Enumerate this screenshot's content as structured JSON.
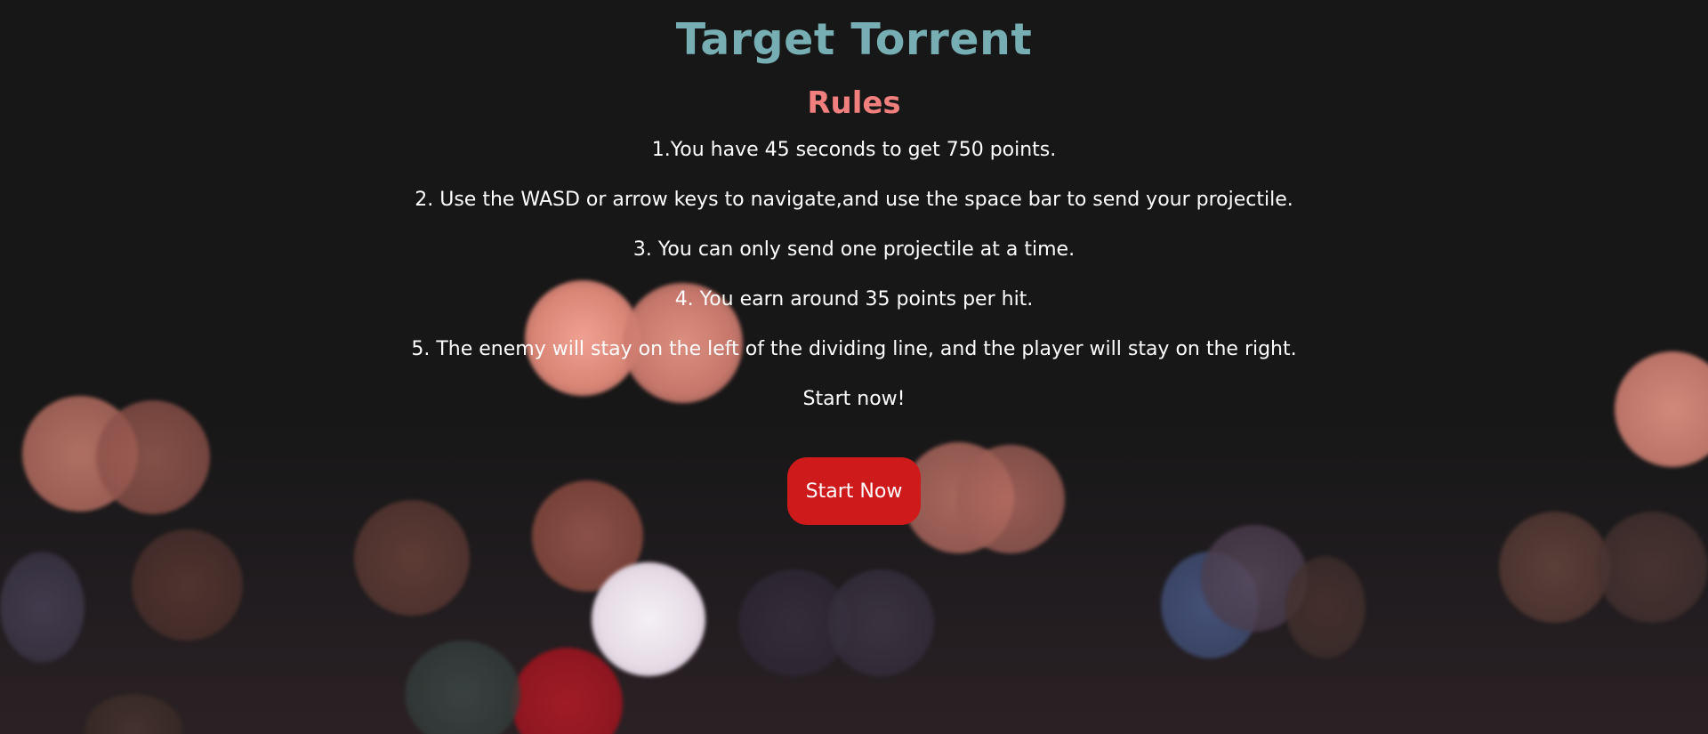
{
  "game": {
    "title": "Target Torrent"
  },
  "rules": {
    "heading": "Rules",
    "items": [
      "1.You have 45 seconds to get 750 points.",
      "2. Use the WASD or arrow keys to navigate,and use the space bar to send your projectile.",
      "3. You can only send one projectile at a time.",
      "4. You earn around 35 points per hit.",
      "5. The enemy will stay on the left of the dividing line, and the player will stay on the right."
    ],
    "call_to_action": "Start now!"
  },
  "start_button": {
    "label": "Start Now"
  },
  "colors": {
    "background": "#171717",
    "title": "#76aeb4",
    "rules_heading": "#f07f7d",
    "button": "#cf1a1c",
    "text": "#ffffff"
  }
}
